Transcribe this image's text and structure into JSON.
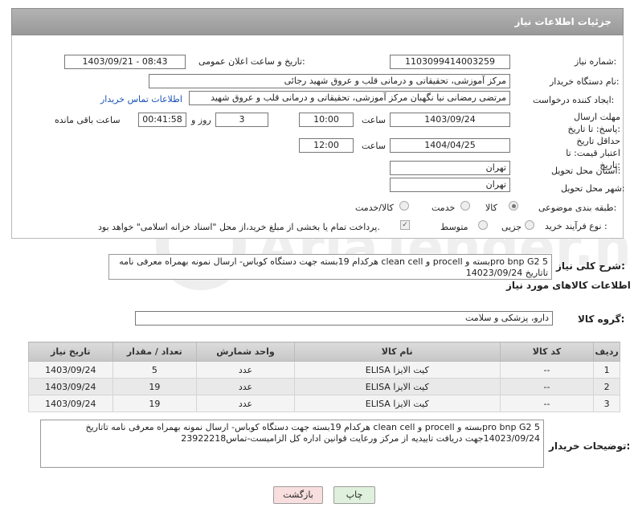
{
  "header": {
    "title": "جزئیات اطلاعات نیاز"
  },
  "labels": {
    "need_number": "شماره نیاز:",
    "announce_datetime": "تاریخ و ساعت اعلان عمومی:",
    "buyer_org": "نام دستگاه خریدار:",
    "requester": "ایجاد کننده درخواست:",
    "reply_deadline": "مهلت ارسال پاسخ: تا تاریخ:",
    "time": "ساعت",
    "days_and": "روز و",
    "remaining": "ساعت باقی مانده",
    "price_validity": "حداقل تاریخ اعتبار قیمت: تا تاریخ:",
    "province": "استان محل تحویل:",
    "city": "شهر محل تحویل:",
    "category": "طبقه بندی موضوعی:",
    "purchase_type": "نوع فرآیند خرید :",
    "general_desc": "شرح کلی نیاز:",
    "goods_info": "اطلاعات کالاهای مورد نیاز",
    "goods_group": "گروه کالا:",
    "buyer_notes": "توضیحات خریدار:"
  },
  "fields": {
    "need_number": "1103099414003259",
    "announce_datetime": "1403/09/21 - 08:43",
    "buyer_org": "مرکز آموزشی، تحقیقاتی و درمانی قلب و عروق شهید رجائی",
    "requester": "مرتضی رمضانی نیا نگهبان مرکز آموزشی، تحقیقاتی و درمانی قلب و عروق شهید",
    "contact_link": "اطلاعات تماس خریدار",
    "reply_date": "1403/09/24",
    "reply_time": "10:00",
    "reply_days": "3",
    "reply_remaining": "00:41:58",
    "validity_date": "1404/04/25",
    "validity_time": "12:00",
    "province": "تهران",
    "city": "تهران",
    "goods_group": "دارو، پزشکی و سلامت"
  },
  "category_options": [
    "کالا",
    "خدمت",
    "کالا/خدمت"
  ],
  "category_selected": "کالا",
  "purchase_options": [
    "جزیی",
    "متوسط"
  ],
  "payment_note": "پرداخت تمام یا بخشی از مبلغ خرید،از محل \"اسناد خزانه اسلامی\" خواهد بود.",
  "general_desc_text": "pro bnp G2 5بسته و procell و clean cell هرکدام 19بسته جهت دستگاه کوباس- ارسال نمونه بهمراه معرفی نامه تاتاریخ 14023/09/24",
  "table": {
    "headers": [
      "ردیف",
      "کد کالا",
      "نام کالا",
      "واحد شمارش",
      "تعداد / مقدار",
      "تاریخ نیاز"
    ],
    "rows": [
      [
        "1",
        "--",
        "کیت الایزا ELISA",
        "عدد",
        "5",
        "1403/09/24"
      ],
      [
        "2",
        "--",
        "کیت الایزا ELISA",
        "عدد",
        "19",
        "1403/09/24"
      ],
      [
        "3",
        "--",
        "کیت الایزا ELISA",
        "عدد",
        "19",
        "1403/09/24"
      ]
    ]
  },
  "buyer_notes_text": "pro bnp G2 5بسته و procell و clean cell هرکدام 19بسته جهت دستگاه کوباس- ارسال نمونه بهمراه معرفی نامه تاتاریخ 14023/09/24جهت دریافت تاییدیه از مرکز ورعایت قوانین اداره کل الزامیست-تماس23922218",
  "buttons": {
    "print": "چاپ",
    "back": "بازگشت"
  },
  "watermark_text": "AriaTender.net"
}
